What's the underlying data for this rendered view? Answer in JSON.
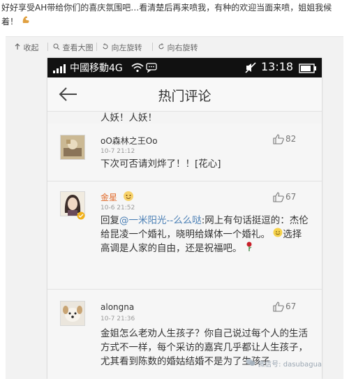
{
  "post": {
    "text": "好好享受AH带给你们的喜庆氛围吧…看清楚后再来喷我，有种的欢迎当面来喷，姐姐我候着！",
    "emoji": "flexed-biceps-icon"
  },
  "toolbar": {
    "collapse": "收起",
    "view_large": "查看大图",
    "rotate_left": "向左旋转",
    "rotate_right": "向右旋转"
  },
  "phone": {
    "status": {
      "carrier": "中國移動4G",
      "time": "13:18"
    },
    "header": {
      "title": "热门评论"
    },
    "top_fragment": "人妖！人妖！",
    "comments": [
      {
        "name": "oO森林之王Oo",
        "time": "10-7 21:12",
        "likes": "82",
        "text": "下次可否请刘烨了！！[花心]"
      },
      {
        "name": "金星",
        "time": "10-6 21:52",
        "likes": "67",
        "reply_prefix": "回复",
        "reply_target": "@一米阳光--么么哒",
        "text_after_link": ":网上有句话挺逗的：杰伦给昆凌一个婚礼，晓明给媒体一个婚礼。",
        "text_end": "选择高调是人家的自由，还是祝福吧。"
      },
      {
        "name": "alongna",
        "time": "10-7 21:36",
        "likes": "67",
        "text": "金姐怎么老劝人生孩子？你自己说过每个人的生活方式不一样，每个采访的嘉宾几乎都让人生孩子，尤其看到陈数的婚姑结婚不是为了生孩子"
      }
    ]
  },
  "watermark": "微信号: dasubagua",
  "colors": {
    "link": "#4a7fb5",
    "status_bar": "#111111",
    "vip_badge": "#f2b21b"
  }
}
